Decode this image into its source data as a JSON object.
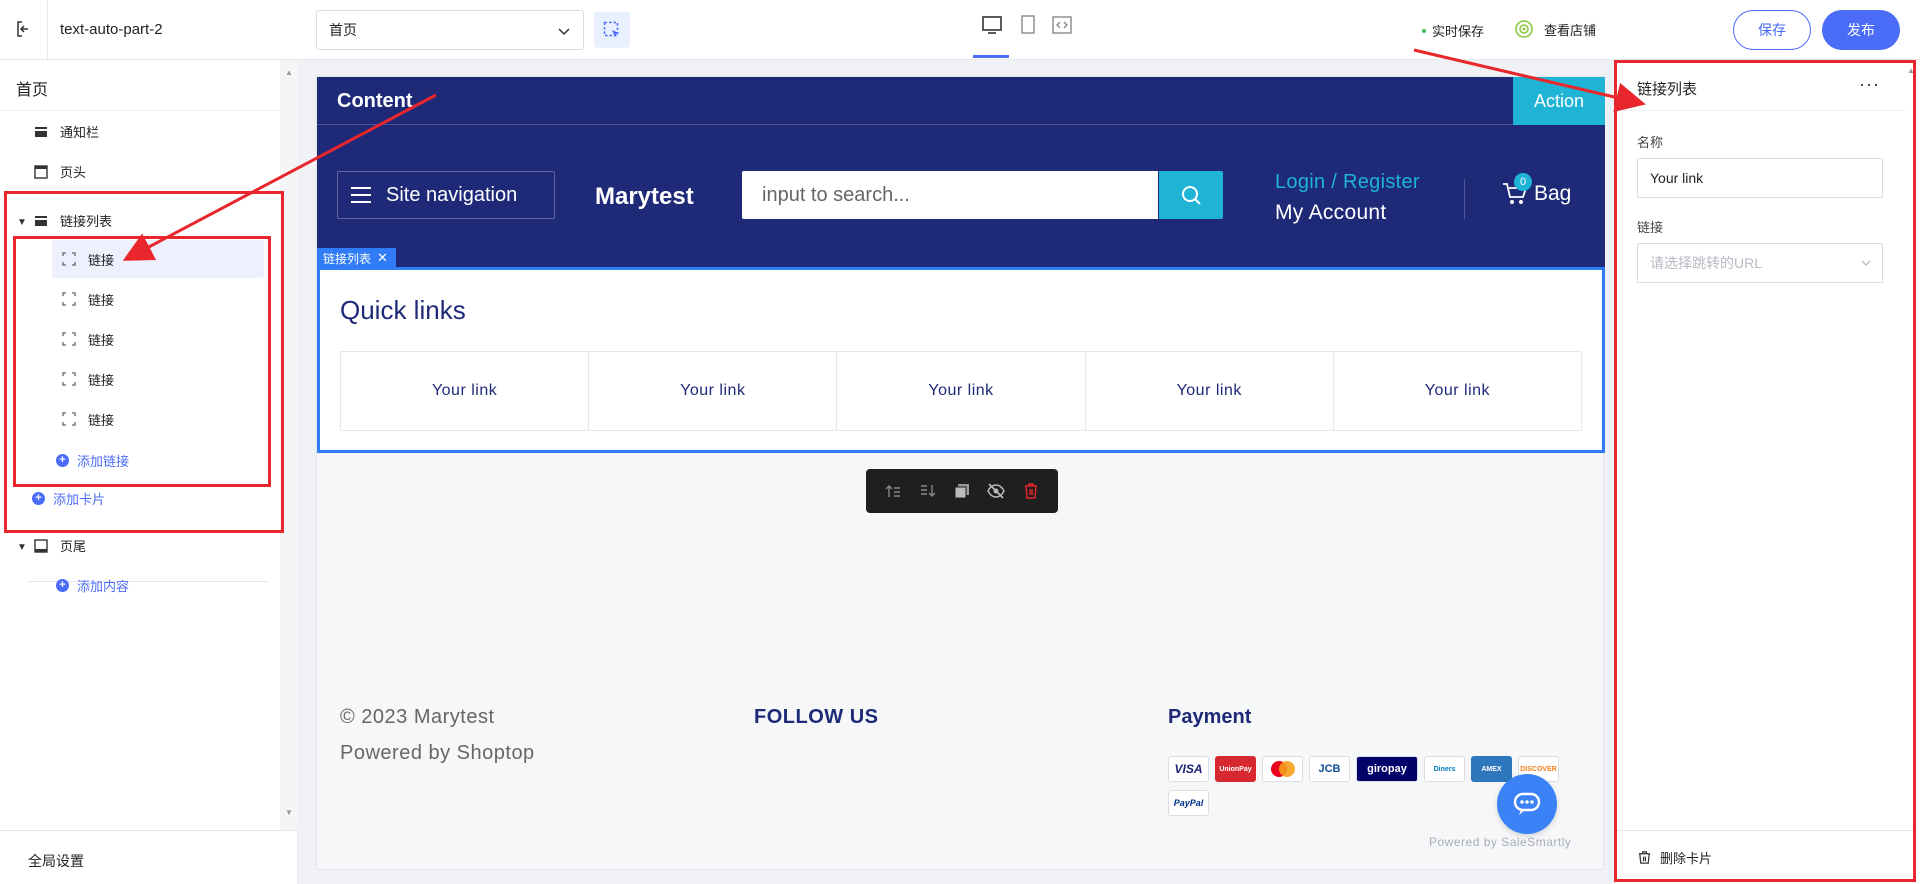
{
  "topbar": {
    "project_name": "text-auto-part-2",
    "page_select_value": "首页",
    "autosave_label": "实时保存",
    "view_store_label": "查看店铺",
    "save_label": "保存",
    "publish_label": "发布"
  },
  "sidebar": {
    "title": "首页",
    "items": {
      "notice_bar": "通知栏",
      "header": "页头",
      "link_list": "链接列表",
      "footer": "页尾"
    },
    "links": [
      "链接",
      "链接",
      "链接",
      "链接",
      "链接"
    ],
    "add_link": "添加链接",
    "add_card": "添加卡片",
    "add_content": "添加内容",
    "global_settings": "全局设置"
  },
  "preview": {
    "announcement_text": "Content",
    "announcement_action": "Action",
    "site_nav_label": "Site navigation",
    "brand": "Marytest",
    "search_placeholder": "input to search...",
    "login_label": "Login / Register",
    "account_label": "My Account",
    "cart_count": "0",
    "bag_label": "Bag",
    "selection_tag": "链接列表",
    "quick_links_title": "Quick links",
    "quick_links": [
      "Your link",
      "Your link",
      "Your link",
      "Your link",
      "Your link"
    ],
    "footer_copyright": "© 2023 Marytest",
    "footer_powered": "Powered by Shoptop",
    "footer_follow": "FOLLOW US",
    "footer_payment": "Payment",
    "payment_methods": [
      "VISA",
      "UnionPay",
      "Mastercard",
      "JCB",
      "giropay",
      "Diners Club",
      "American Express",
      "DISCOVER",
      "PayPal"
    ],
    "salesmartly": "Powered by SaleSmartly"
  },
  "colors": {
    "brand_navy": "#1e2a78",
    "accent_cyan": "#1fb3d6",
    "editor_blue": "#4a6cf7",
    "selection_blue": "#2f7cf6",
    "annotation_red": "#e8262b"
  },
  "settings": {
    "title": "链接列表",
    "more_icon": "···",
    "name_label": "名称",
    "name_value": "Your link",
    "link_label": "链接",
    "link_placeholder": "请选择跳转的URL",
    "delete_card": "删除卡片"
  }
}
